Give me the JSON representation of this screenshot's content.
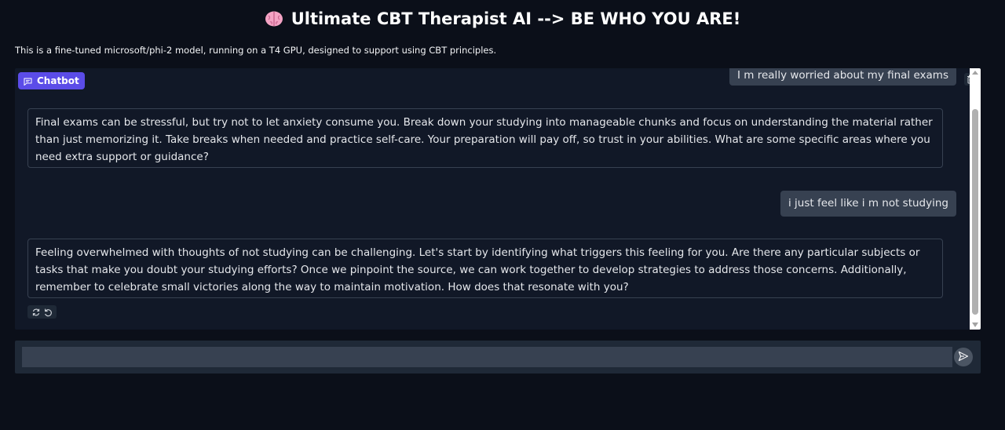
{
  "header": {
    "icon": "brain-icon",
    "title": "Ultimate CBT Therapist AI --> BE WHO YOU ARE!",
    "description": "This is a fine-tuned microsoft/phi-2 model, running on a T4 GPU, designed to support using CBT principles."
  },
  "chatbot": {
    "label": "Chatbot",
    "messages": [
      {
        "role": "user",
        "text": "I m really worried about my final exams"
      },
      {
        "role": "bot",
        "text": "Final exams can be stressful, but try not to let anxiety consume you. Break down your studying into manageable chunks and focus on understanding the material rather than just memorizing it. Take breaks when needed and practice self-care. Your preparation will pay off, so trust in your abilities. What are some specific areas where you need extra support or guidance?"
      },
      {
        "role": "user",
        "text": "i just feel like i m not studying"
      },
      {
        "role": "bot",
        "text": "Feeling overwhelmed with thoughts of not studying can be challenging. Let's start by identifying what triggers this feeling for you. Are there any particular subjects or tasks that make you doubt your studying efforts? Once we pinpoint the source, we can work together to develop strategies to address those concerns. Additionally, remember to celebrate small victories along the way to maintain motivation. How does that resonate with you?"
      }
    ]
  },
  "input": {
    "value": "",
    "placeholder": ""
  },
  "colors": {
    "background": "#0b0f19",
    "panel": "#111827",
    "accent": "#5b4ce8",
    "user_bubble": "#374151"
  }
}
